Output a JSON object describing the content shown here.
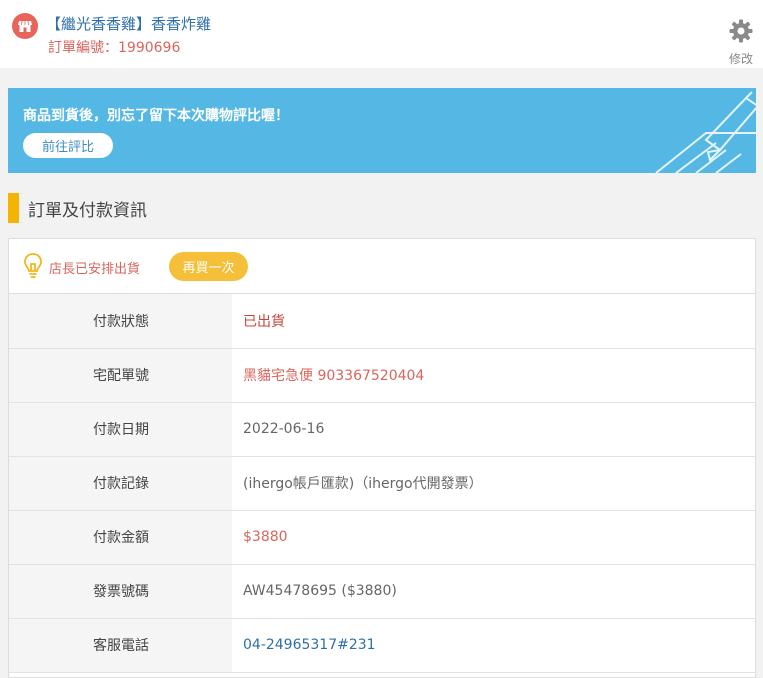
{
  "header": {
    "store_name": "【繼光香香雞】香香炸雞",
    "order_number": "訂單編號：1990696",
    "edit_label": "修改"
  },
  "banner": {
    "message": "商品到貨後，別忘了留下本次購物評比喔！",
    "button_label": "前往評比"
  },
  "section": {
    "title": "訂單及付款資訊"
  },
  "status": {
    "text": "店長已安排出貨",
    "rebuy_label": "再買一次"
  },
  "rows": [
    {
      "label": "付款狀態",
      "value": "已出貨"
    },
    {
      "label": "宅配單號",
      "value": "黑貓宅急便 903367520404"
    },
    {
      "label": "付款日期",
      "value": "2022-06-16"
    },
    {
      "label": "付款記錄",
      "value": "(ihergo帳戶匯款)（ihergo代開發票）"
    },
    {
      "label": "付款金額",
      "value": "$3880"
    },
    {
      "label": "發票號碼",
      "value": "AW45478695 ($3880)"
    },
    {
      "label": "客服電話",
      "value": "04-24965317#231"
    }
  ],
  "colors": {
    "banner_bg": "#55b8e4",
    "accent_yellow": "#f6bf3a",
    "section_bar": "#f4b400",
    "store_badge": "#e8645a",
    "link_blue": "#2f6fa8",
    "alert_red": "#d9655c"
  }
}
